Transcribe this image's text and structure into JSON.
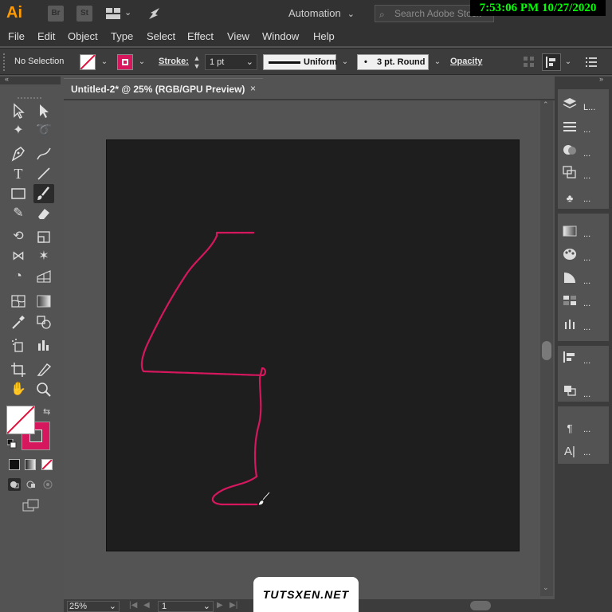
{
  "app": {
    "logo": "Ai",
    "bridge_label": "Br",
    "stock_label": "St",
    "workspace": "Automation",
    "search_placeholder": "Search Adobe Stock"
  },
  "clock": "7:53:06 PM 10/27/2020",
  "menu": [
    "File",
    "Edit",
    "Object",
    "Type",
    "Select",
    "Effect",
    "View",
    "Window",
    "Help"
  ],
  "control": {
    "selection": "No Selection",
    "stroke_label": "Stroke:",
    "stroke_weight": "1 pt",
    "stroke_profile": "Uniform",
    "brush": "3 pt. Round",
    "opacity_label": "Opacity",
    "fill_color": "#ffffff",
    "stroke_color": "#d6175e"
  },
  "document": {
    "tab_title": "Untitled-2* @ 25% (RGB/GPU Preview)",
    "close_glyph": "×",
    "zoom": "25%",
    "page": "1"
  },
  "right_panel": {
    "layers_label": "L...",
    "more": "..."
  },
  "watermark": "TUTSXEN.NET"
}
